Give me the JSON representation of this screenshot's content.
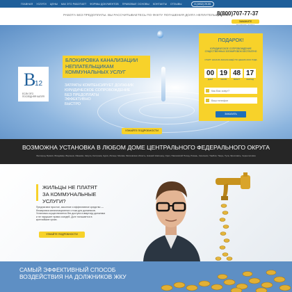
{
  "nav": {
    "items": [
      "ГЛАВНАЯ",
      "УСЛУГИ",
      "ЦЕНЫ",
      "КАК ЭТО РАБОТАЕТ",
      "ФОРМЫ ДОКУМЕНТОВ",
      "ПРАВОВЫЕ ОСНОВЫ",
      "КОНТАКТЫ",
      "ОТЗЫВЫ"
    ],
    "phone_pill": "8 (4932) 29-55"
  },
  "header": {
    "tagline": "РАБОТА БЕЗ ПРЕДОПЛАТЫ. ВЫ РАССЧИТЫВАЕТЕСЬ ПО ФАКТУ ПОГАШЕНИЯ ДОЛГА НЕПЛАТЕЛЬЩИКАМИ",
    "phone": "8(800)707-77-37",
    "call_button": "ЗАКАЖИТЕ ПОДРОБНОСТИ"
  },
  "logo": {
    "letter": "B",
    "number": "12",
    "subtitle": "ЕСЛИ ЭТО ПОСЛЕДНЯЯ КАПЛЯ"
  },
  "hero": {
    "title_lines": [
      "БЛОКИРОВКА КАНАЛИЗАЦИИ",
      "НЕПЛАТЕЛЬЩИКАМ",
      "КОММУНАЛЬНЫХ УСЛУГ"
    ],
    "desc_lines": [
      "ЗАТРАТЫ КОМПЕНСИРУЕТ ДОЛЖНИК",
      "ЮРИДИЧЕСКОЕ СОПРОВОЖДЕНИЕ",
      "БЕЗ ПРЕДОПЛАТЫ",
      "ЭФФЕКТИВНО",
      "БЫСТРО"
    ],
    "cta": "УЗНАЙТЕ ПОДРОБНОСТИ"
  },
  "offer": {
    "title": "ПОДАРОК!",
    "text": "ЮРИДИЧЕСКОЕ СОПРОВОЖДЕНИЕ СУЩЕСТВЕННЫХ БЛОКИРОВОК БЕСПЛАТНО",
    "subtext": "СТАРТ НАЧАЛА ЗАКАЗА ЕЩЁ ПО ЦЕНАМ 2013 ГОДА",
    "timer": [
      {
        "value": "00",
        "unit": "ДНЕЙ"
      },
      {
        "value": "19",
        "unit": "ЧАСОВ"
      },
      {
        "value": "48",
        "unit": "МИНУТ"
      },
      {
        "value": "17",
        "unit": "СЕКУНД"
      }
    ],
    "name_placeholder": "Как Вас зовут?",
    "phone_placeholder": "Ваш телефон",
    "submit": "ЗАКАЗАТЬ"
  },
  "band": {
    "title": "ВОЗМОЖНА УСТАНОВКА В ЛЮБОМ ДОМЕ ЦЕНТРАЛЬНОГО ФЕДЕРАЛЬНОГО ОКРУГА",
    "cities": "Белгород, Брянск, Владимир, Воронеж, Иваново, Калуга, Кострома, Курск, Липецк, Москва, Московская область, Нижний Новгород, Орел, Павловский Посад, Рязань, Смоленск, Тамбов, Тверь, Тула, Ярославль, Черноголовка"
  },
  "section2": {
    "question_lines": [
      "ЖИЛЬЦЫ НЕ ПЛАТЯТ",
      "ЗА КОММУНАЛЬНЫЕ УСЛУГИ?"
    ],
    "text": "Предлагаем простое, законное и эффективное средство — блокировка канализационного стока для должников. Установка осуществляется без доступа в квартиру должника и не нарушает права соседей. Долг погашается в кратчайшие сроки.",
    "button": "УЗНАЙТЕ ПОДРОБНОСТИ"
  },
  "bottom": {
    "title_lines": [
      "САМЫЙ ЭФФЕКТИВНЫЙ СПОСОБ",
      "ВОЗДЕЙСТВИЯ НА ДОЛЖНИКОВ ЖКУ"
    ]
  },
  "colors": {
    "primary_blue": "#1f5f9a",
    "accent_yellow": "#f7d22a",
    "dark_band": "#262626"
  }
}
